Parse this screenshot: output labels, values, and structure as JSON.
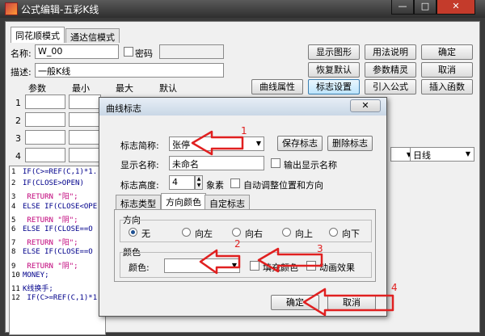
{
  "window": {
    "title": "公式编辑-五彩K线",
    "controls": [
      "—",
      "□",
      "✕"
    ]
  },
  "tabs": [
    "同花顺模式",
    "通达信模式"
  ],
  "form": {
    "name_label": "名称:",
    "name_value": "W_00",
    "password_label": "密码",
    "desc_label": "描述:",
    "desc_value": "一般K线"
  },
  "right_buttons": [
    "显示图形",
    "用法说明",
    "确定",
    "恢复默认",
    "参数精灵",
    "取消"
  ],
  "mid_buttons": [
    "曲线属性",
    "标志设置",
    "引入公式",
    "插入函数"
  ],
  "params": {
    "headers": [
      "参数",
      "最小",
      "最大",
      "默认"
    ],
    "rows": [
      "1",
      "2",
      "3",
      "4"
    ]
  },
  "period_select": "日线",
  "code_lines": [
    {
      "num": "1",
      "text": "IF(C>=REF(C,1)*1."
    },
    {
      "num": "2",
      "text": "IF(CLOSE>OPEN)"
    },
    {
      "num": "3",
      "text": " RETURN \"阳\";"
    },
    {
      "num": "4",
      "text": "ELSE IF(CLOSE<OPE"
    },
    {
      "num": "5",
      "text": " RETURN \"阴\";"
    },
    {
      "num": "6",
      "text": "ELSE  IF(CLOSE==O"
    },
    {
      "num": "7",
      "text": " RETURN \"阳\";"
    },
    {
      "num": "8",
      "text": "ELSE  IF(CLOSE==O"
    },
    {
      "num": "9",
      "text": " RETURN \"阴\";"
    },
    {
      "num": "10",
      "text": "MONEY;"
    },
    {
      "num": "11",
      "text": "K线换手;"
    },
    {
      "num": "12",
      "text": " IF(C>=REF(C,1)*1"
    }
  ],
  "dialog": {
    "title": "曲线标志",
    "close": "✕",
    "abbr_label": "标志简称:",
    "abbr_value": "张停",
    "save_label": "保存标志",
    "delete_label": "删除标志",
    "display_label": "显示名称:",
    "display_value": "未命名",
    "output_label": "输出显示名称",
    "height_label": "标志高度:",
    "height_value": "4",
    "height_unit": "象素",
    "auto_label": "自动调整位置和方向",
    "tabs": [
      "标志类型",
      "方向颜色",
      "自定标志"
    ],
    "direction_group": "方向",
    "directions": [
      "无",
      "向左",
      "向右",
      "向上",
      "向下"
    ],
    "color_group": "颜色",
    "color_label": "颜色:",
    "fill_label": "填充颜色",
    "anim_label": "动画效果",
    "ok_label": "确定",
    "cancel_label": "取消"
  },
  "annotations": [
    "1",
    "2",
    "3",
    "4"
  ],
  "colors": {
    "arrow": "#e02020",
    "accent": "#3c7fb1"
  }
}
